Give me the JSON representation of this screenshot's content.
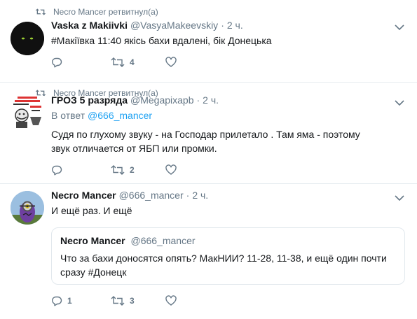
{
  "colors": {
    "text": "#14171a",
    "muted": "#657786",
    "link": "#1da1f2",
    "border": "#e6ecf0"
  },
  "tweets": [
    {
      "retweeted_by": "Necro Mancer ретвитнул(а)",
      "name": "Vaska z Makiivki",
      "handle": "@VasyaMakeevskiy",
      "dot": "·",
      "time": "2 ч.",
      "text": "#Макіївка 11:40 якісь бахи вдалені, бік Донецька",
      "retweets": "4"
    },
    {
      "retweeted_by": "Necro Mancer ретвитнул(а)",
      "name": "ГРОЗ 5 разряда",
      "handle": "@Megapixapb",
      "dot": "·",
      "time": "2 ч.",
      "reply_prefix": "В ответ",
      "reply_handle": "@666_mancer",
      "text": "Судя по глухому звуку - на Господар прилетало . Там яма - поэтому звук отличается от ЯБП или промки.",
      "retweets": "2"
    },
    {
      "name": "Necro Mancer",
      "handle": "@666_mancer",
      "dot": "·",
      "time": "2 ч.",
      "text": "И ещё раз. И ещё",
      "replies": "1",
      "retweets": "3",
      "quote": {
        "name": "Necro Mancer",
        "handle": "@666_mancer",
        "text": "Что за бахи доносятся опять? МакНИИ? 11-28, 11-38, и ещё один почти сразу #Донецк"
      }
    }
  ]
}
